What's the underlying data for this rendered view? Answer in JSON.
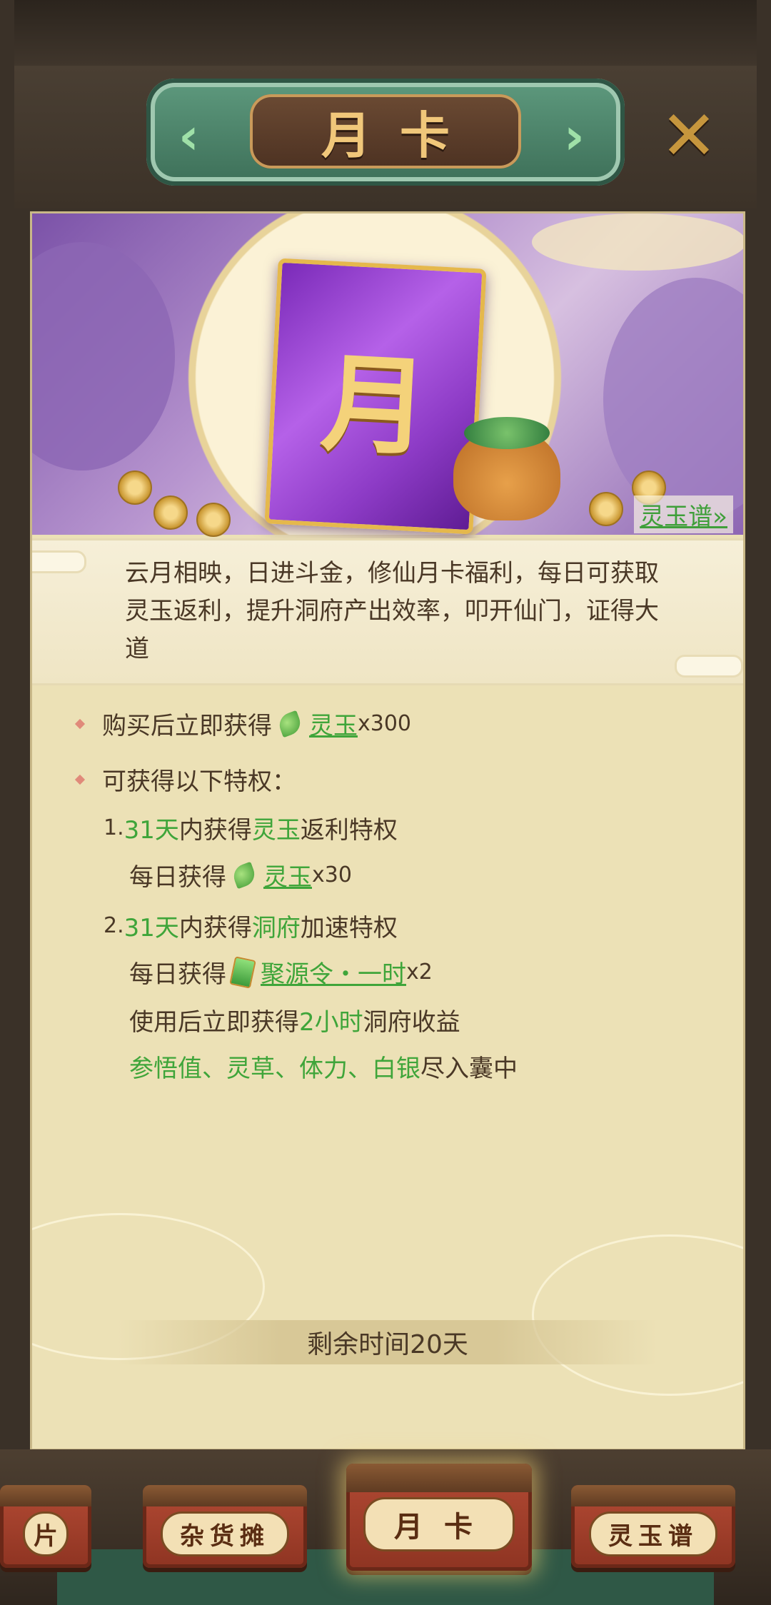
{
  "header": {
    "title": "月卡"
  },
  "banner": {
    "card_glyph": "月",
    "jade_link": "灵玉谱»"
  },
  "description": "云月相映，日进斗金，修仙月卡福利，每日可获取灵玉返利，提升洞府产出效率，叩开仙门，证得大道",
  "purchase": {
    "prefix": "购买后立即获得",
    "item": "灵玉",
    "qty": "x300"
  },
  "privileges_heading": "可获得以下特权：",
  "privilege1": {
    "num": "1.",
    "days": "31天",
    "mid": "内获得",
    "item": "灵玉",
    "suffix": "返利特权",
    "daily_prefix": "每日获得",
    "daily_item": "灵玉",
    "daily_qty": "x30"
  },
  "privilege2": {
    "num": "2.",
    "days": "31天",
    "mid": "内获得",
    "item": "洞府",
    "suffix": "加速特权",
    "daily_prefix": "每日获得",
    "daily_item": "聚源令・一时",
    "daily_qty": "x2",
    "use_prefix": "使用后立即获得",
    "use_hours": "2小时",
    "use_suffix": "洞府收益",
    "rewards": "参悟值、灵草、体力、白银",
    "rewards_suffix": "尽入囊中"
  },
  "remaining": "剩余时间20天",
  "tabs": [
    {
      "label": "片"
    },
    {
      "label": "杂货摊"
    },
    {
      "label": "月卡"
    },
    {
      "label": "灵玉谱"
    }
  ],
  "colors": {
    "accent_green": "#3fa53a",
    "panel": "#ece1b6",
    "title_gold": "#f0c77a"
  }
}
